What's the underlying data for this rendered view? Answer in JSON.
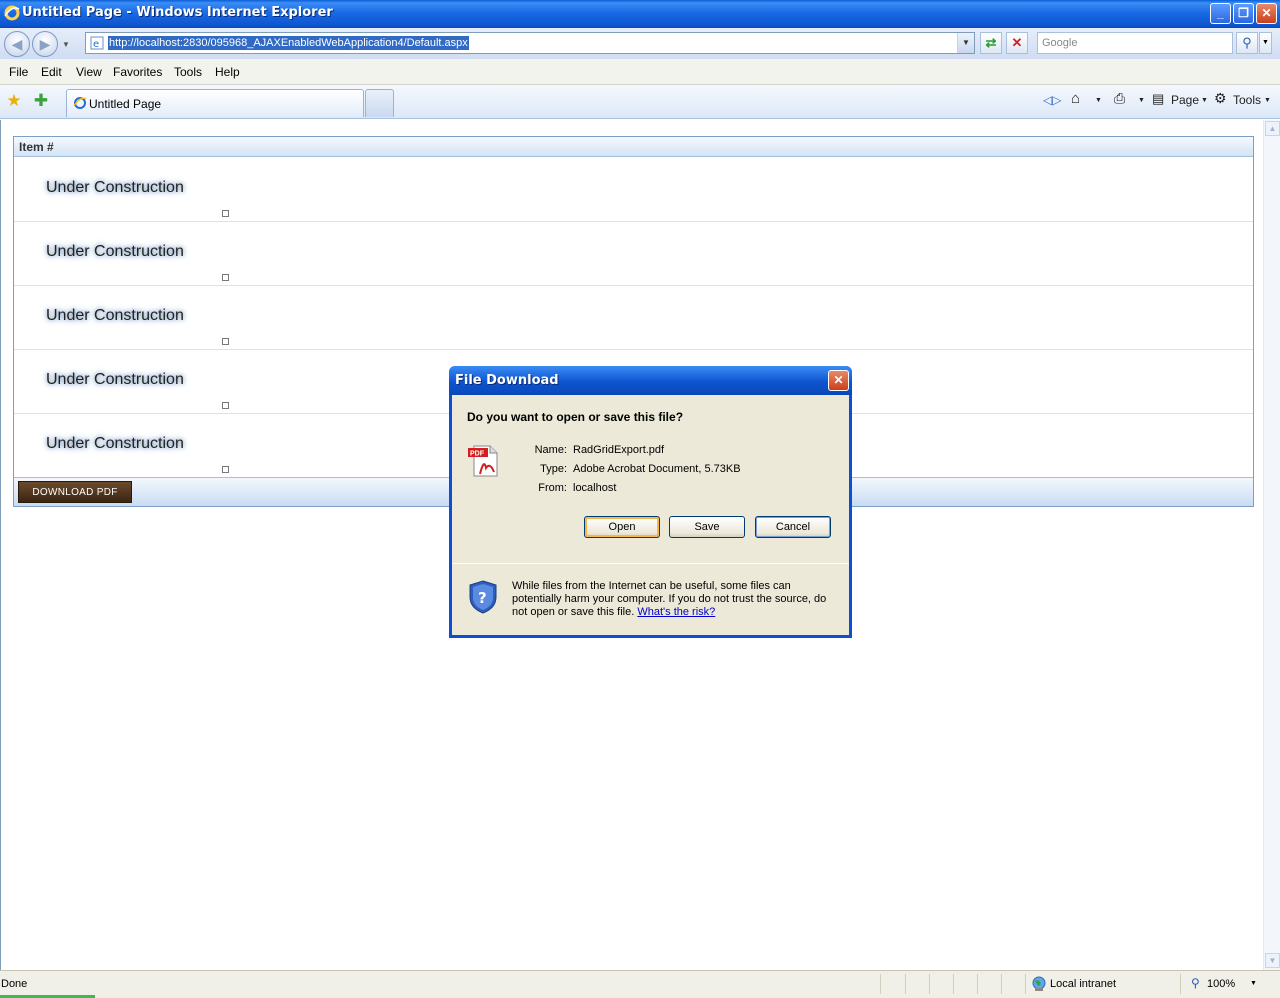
{
  "window": {
    "title": "Untitled Page - Windows Internet Explorer"
  },
  "address_bar": {
    "url": "http://localhost:2830/095968_AJAXEnabledWebApplication4/Default.aspx",
    "search_placeholder": "Google"
  },
  "menu": {
    "items": [
      "File",
      "Edit",
      "View",
      "Favorites",
      "Tools",
      "Help"
    ]
  },
  "tabs": [
    {
      "label": "Untitled Page"
    }
  ],
  "command_bar": {
    "page_label": "Page",
    "tools_label": "Tools"
  },
  "grid": {
    "header": "Item #",
    "rows": [
      {
        "text": "Under Construction"
      },
      {
        "text": "Under Construction"
      },
      {
        "text": "Under Construction"
      },
      {
        "text": "Under Construction"
      },
      {
        "text": "Under Construction"
      }
    ],
    "download_button": "DOWNLOAD PDF"
  },
  "dialog": {
    "title": "File Download",
    "question": "Do you want to open or save this file?",
    "name_label": "Name:",
    "name_value": "RadGridExport.pdf",
    "type_label": "Type:",
    "type_value": "Adobe Acrobat Document, 5.73KB",
    "from_label": "From:",
    "from_value": "localhost",
    "open_button": "Open",
    "save_button": "Save",
    "cancel_button": "Cancel",
    "warning_text": "While files from the Internet can be useful, some files can potentially harm your computer. If you do not trust the source, do not open or save this file.",
    "risk_link": "What's the risk?"
  },
  "status_bar": {
    "status": "Done",
    "zone": "Local intranet",
    "zoom": "100%"
  }
}
